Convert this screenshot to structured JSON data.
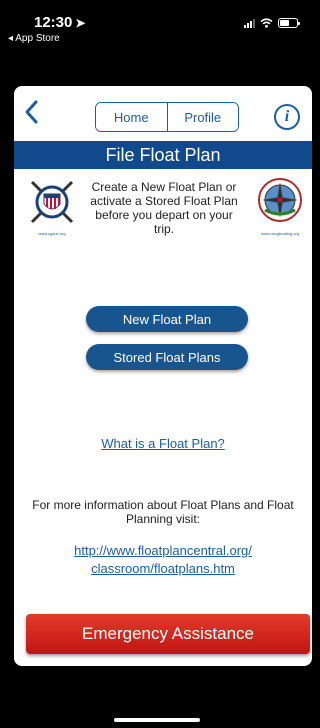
{
  "status_bar": {
    "time": "12:30",
    "back_app": "◂ App Store"
  },
  "nav": {
    "home_label": "Home",
    "profile_label": "Profile",
    "info_label": "i"
  },
  "title": "File Float Plan",
  "intro_text": "Create a New Float Plan or activate a Stored Float Plan before you depart on your trip.",
  "logos": {
    "left_url": "www.cgaux.org",
    "right_url": "www.uscgboating.org"
  },
  "buttons": {
    "new_float_plan": "New Float Plan",
    "stored_float_plans": "Stored Float Plans"
  },
  "what_link": "What is a Float Plan?",
  "more_info_text": "For more information about Float Plans and Float Planning visit:",
  "url_lines": [
    "http://www.floatplancentral.org/",
    "classroom/floatplans.htm"
  ],
  "emergency_label": "Emergency Assistance",
  "colors": {
    "brand_blue": "#104a8c",
    "link_blue": "#1a5ea6",
    "emergency_red": "#d7261c"
  }
}
